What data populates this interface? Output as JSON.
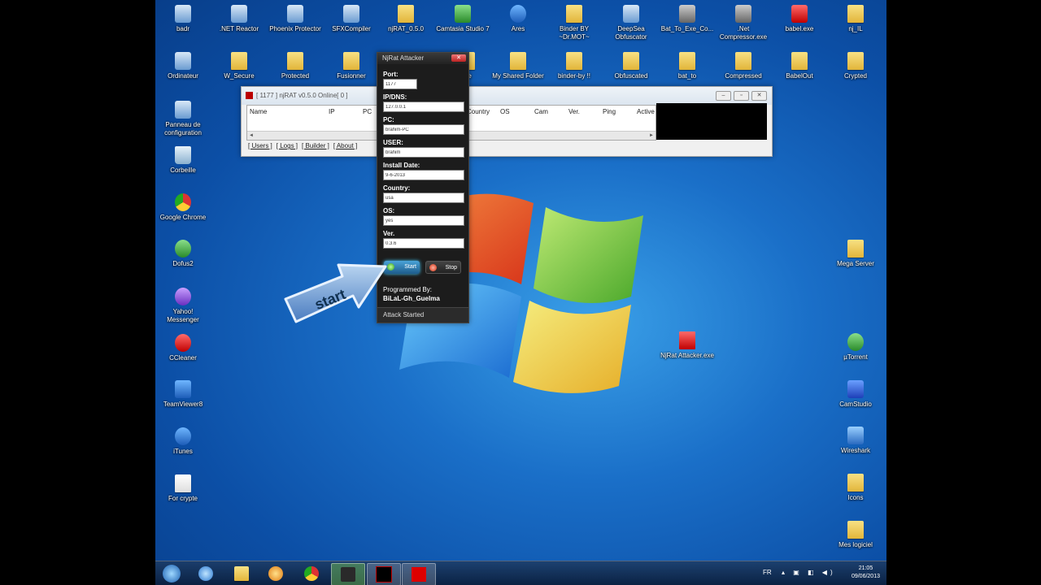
{
  "desktop_icons": [
    {
      "label": "badr",
      "kind": "app"
    },
    {
      "label": ".NET Reactor",
      "kind": "app"
    },
    {
      "label": "Phoenix Protector",
      "kind": "app"
    },
    {
      "label": "SFXCompiler",
      "kind": "app"
    },
    {
      "label": "njRAT_0.5.0",
      "kind": "folder"
    },
    {
      "label": "Camtasia Studio 7",
      "kind": "app"
    },
    {
      "label": "Ares",
      "kind": "app"
    },
    {
      "label": "Binder BY ~Dr.MOT~",
      "kind": "folder"
    },
    {
      "label": "DeepSea Obfuscator",
      "kind": "app"
    },
    {
      "label": "Bat_To_Exe_Co...",
      "kind": "app"
    },
    {
      "label": ".Net Compressor.exe",
      "kind": "app"
    },
    {
      "label": "babel.exe",
      "kind": "app"
    },
    {
      "label": "nj_IL",
      "kind": "folder"
    },
    {
      "label": "Ordinateur",
      "kind": "app"
    },
    {
      "label": "W_Secure",
      "kind": "folder"
    },
    {
      "label": "Protected",
      "kind": "folder"
    },
    {
      "label": "Fusionner",
      "kind": "folder"
    },
    {
      "label": "ure",
      "kind": "folder"
    },
    {
      "label": "My Shared Folder",
      "kind": "folder"
    },
    {
      "label": "binder-by !!",
      "kind": "folder"
    },
    {
      "label": "Obfuscated",
      "kind": "folder"
    },
    {
      "label": "bat_to",
      "kind": "folder"
    },
    {
      "label": "Compressed",
      "kind": "folder"
    },
    {
      "label": "BabelOut",
      "kind": "folder"
    },
    {
      "label": "Crypted",
      "kind": "folder"
    },
    {
      "label": "Panneau de configuration",
      "kind": "app"
    },
    {
      "label": "Corbeille",
      "kind": "app"
    },
    {
      "label": "Google Chrome",
      "kind": "app"
    },
    {
      "label": "Dofus2",
      "kind": "app"
    },
    {
      "label": "Yahoo! Messenger",
      "kind": "app"
    },
    {
      "label": "CCleaner",
      "kind": "app"
    },
    {
      "label": "TeamViewer8",
      "kind": "app"
    },
    {
      "label": "iTunes",
      "kind": "app"
    },
    {
      "label": "For crypte",
      "kind": "folder"
    },
    {
      "label": "Mega Server",
      "kind": "folder"
    },
    {
      "label": "NjRat Attacker.exe",
      "kind": "app"
    },
    {
      "label": "µTorrent",
      "kind": "app"
    },
    {
      "label": "CamStudio",
      "kind": "app"
    },
    {
      "label": "Wireshark",
      "kind": "app"
    },
    {
      "label": "Icons",
      "kind": "folder"
    },
    {
      "label": "Mes logiciel",
      "kind": "folder"
    }
  ],
  "njrat_window": {
    "title": "[ 1177 ] njRAT v0.5.0 Online[ 0 ]",
    "columns": [
      "Name",
      "IP",
      "PC",
      "Country",
      "OS",
      "Cam",
      "Ver.",
      "Ping",
      "Active"
    ],
    "links": [
      "[ Users ]",
      "[ Logs ]",
      "[ Builder ]",
      "[ About ]"
    ],
    "win_buttons": [
      "–",
      "▫",
      "✕"
    ]
  },
  "attacker_window": {
    "title": "NjRat Attacker",
    "close": "✕",
    "fields": [
      {
        "label": "Port:",
        "value": "1177"
      },
      {
        "label": "IP/DNS:",
        "value": "127.0.0.1"
      },
      {
        "label": "PC:",
        "value": "brahim-PC"
      },
      {
        "label": "USER:",
        "value": "brahim"
      },
      {
        "label": "Install Date:",
        "value": "9-6-2013"
      },
      {
        "label": "Country:",
        "value": "usa"
      },
      {
        "label": "OS:",
        "value": "yes"
      },
      {
        "label": "Ver.",
        "value": "0.3.6"
      }
    ],
    "start_label": "Start",
    "stop_label": "Stop",
    "programmed_by_label": "Programmed By:",
    "author": "BiLaL-Gh_Guelma",
    "status": "Attack Started"
  },
  "annotation": {
    "arrow_text": "start"
  },
  "taskbar": {
    "language": "FR",
    "time": "21:05",
    "date": "09/06/2013",
    "pinned": [
      "start-orb",
      "internet-explorer",
      "explorer",
      "media-player",
      "chrome",
      "camtasia",
      "njrat",
      "njrat-attacker"
    ]
  },
  "colors": {
    "accent": "#4aa3d8",
    "desktop": "#1a6fc8",
    "attacker_bg": "#1c1c1c"
  }
}
